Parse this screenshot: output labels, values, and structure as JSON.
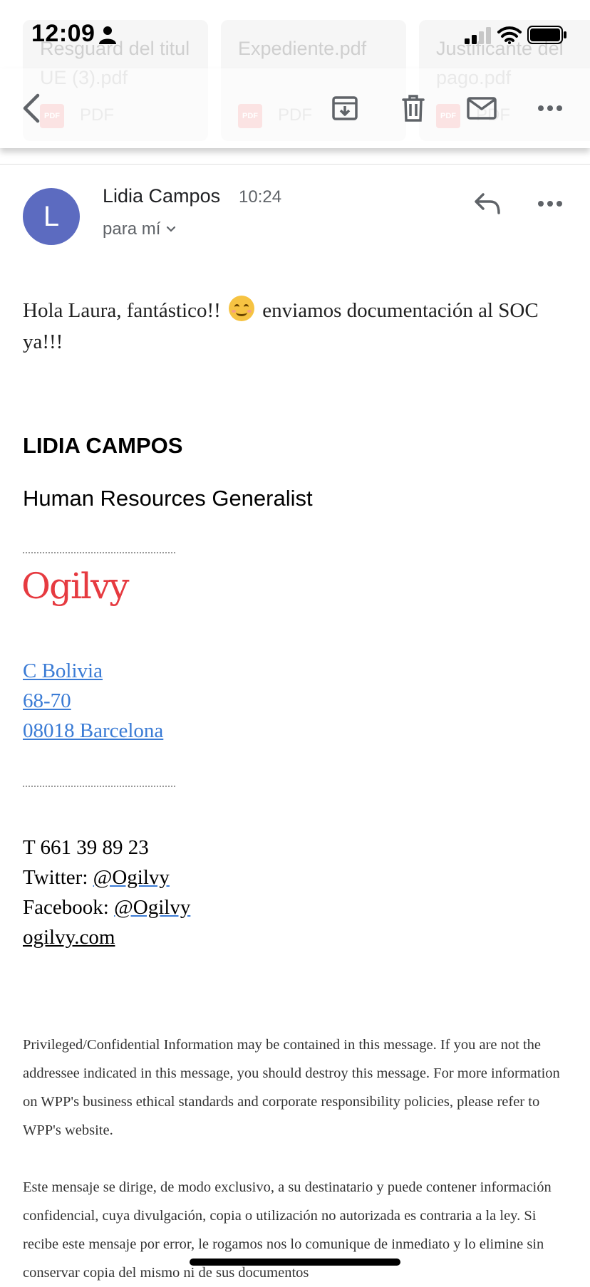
{
  "status_bar": {
    "time": "12:09"
  },
  "attachments": [
    {
      "name": "Resguard del titul\nUE (3).pdf",
      "type": "PDF",
      "icon": "pdf-icon"
    },
    {
      "name": "Expediente.pdf",
      "type": "PDF",
      "icon": "pdf-icon"
    },
    {
      "name": "Justificante del\npago.pdf",
      "type": "PDF",
      "icon": "pdf-icon"
    }
  ],
  "toolbar": {
    "icons": [
      "back-icon",
      "archive-icon",
      "trash-icon",
      "mail-icon",
      "more-icon"
    ]
  },
  "message": {
    "avatar_letter": "L",
    "avatar_color": "#5c6bc0",
    "sender": "Lidia Campos",
    "time": "10:24",
    "recipient": "para mí",
    "greeting_part1": "Hola Laura, fantástico!!",
    "greeting_part2": " enviamos documentación al SOC ya!!!",
    "emoji": "smiling-face-emoji"
  },
  "signature": {
    "name": "LIDIA CAMPOS",
    "role": "Human Resources Generalist",
    "logo_text": "Ogilvy",
    "logo_color": "#e63a40",
    "address_lines": [
      "C Bolivia",
      "68-70",
      "08018 Barcelona"
    ],
    "phone": "T 661 39 89 23",
    "twitter_label": "Twitter: ",
    "twitter_handle": "@Ogilvy",
    "facebook_label": "Facebook: ",
    "facebook_handle": "@Ogilvy",
    "website": "ogilvy.com",
    "link_color": "#3a7bd5"
  },
  "legal": {
    "english": "Privileged/Confidential Information may be contained in this message. If you are not the addressee indicated in this message, you should destroy this message. For more information on WPP's business ethical standards and corporate responsibility policies, please refer to WPP's website.",
    "spanish": "Este mensaje se dirige, de modo exclusivo, a su destinatario y puede contener información confidencial, cuya divulgación, copia o utilización no autorizada es contraria a la ley. Si recibe este mensaje por error, le rogamos nos lo comunique de inmediato y lo elimine sin conservar copia del mismo ni de sus documentos"
  }
}
